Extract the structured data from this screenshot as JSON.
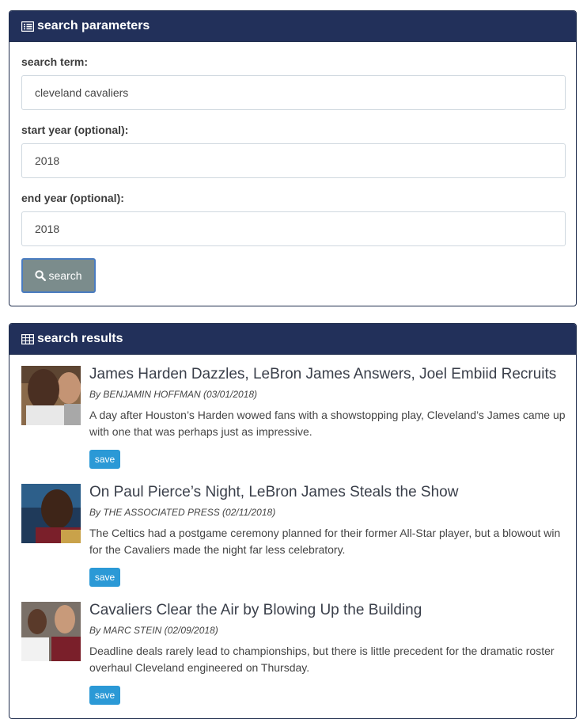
{
  "search_panel": {
    "title": "search parameters",
    "term_label": "search term:",
    "term_value": "cleveland cavaliers",
    "start_label": "start year (optional):",
    "start_value": "2018",
    "end_label": "end year (optional):",
    "end_value": "2018",
    "button_label": "search"
  },
  "results_panel": {
    "title": "search results",
    "items": [
      {
        "title": "James Harden Dazzles, LeBron James Answers, Joel Embiid Recruits",
        "byline": "By BENJAMIN HOFFMAN (03/01/2018)",
        "snippet": "A day after Houston’s Harden wowed fans with a showstopping play, Cleveland’s James came up with one that was perhaps just as impressive.",
        "save_label": "save"
      },
      {
        "title": "On Paul Pierce’s Night, LeBron James Steals the Show",
        "byline": "By THE ASSOCIATED PRESS (02/11/2018)",
        "snippet": "The Celtics had a postgame ceremony planned for their former All-Star player, but a blowout win for the Cavaliers made the night far less celebratory.",
        "save_label": "save"
      },
      {
        "title": "Cavaliers Clear the Air by Blowing Up the Building",
        "byline": "By MARC STEIN (02/09/2018)",
        "snippet": "Deadline deals rarely lead to championships, but there is little precedent for the dramatic roster overhaul Cleveland engineered on Thursday.",
        "save_label": "save"
      }
    ]
  },
  "colors": {
    "header_bg": "#22305a",
    "search_button": "#7b8c8c",
    "save_button": "#2b99d6"
  }
}
